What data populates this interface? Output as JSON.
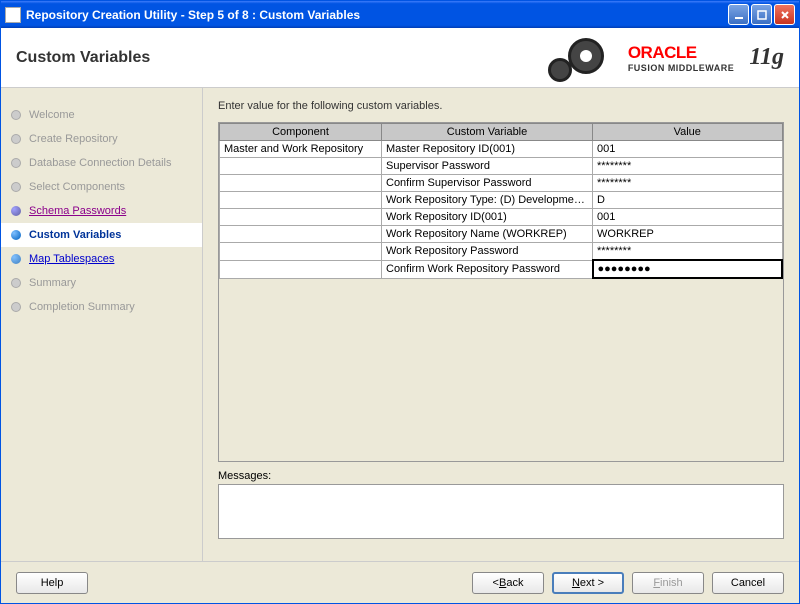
{
  "window": {
    "title": "Repository Creation Utility - Step 5 of 8 : Custom Variables"
  },
  "header": {
    "title": "Custom Variables",
    "brand_main": "ORACLE",
    "brand_sub": "FUSION MIDDLEWARE",
    "brand_version": "11g"
  },
  "sidebar": {
    "steps": [
      {
        "label": "Welcome",
        "state": "disabled"
      },
      {
        "label": "Create Repository",
        "state": "disabled"
      },
      {
        "label": "Database Connection Details",
        "state": "disabled"
      },
      {
        "label": "Select Components",
        "state": "disabled"
      },
      {
        "label": "Schema Passwords",
        "state": "past"
      },
      {
        "label": "Custom Variables",
        "state": "current"
      },
      {
        "label": "Map Tablespaces",
        "state": "future"
      },
      {
        "label": "Summary",
        "state": "disabled"
      },
      {
        "label": "Completion Summary",
        "state": "disabled"
      }
    ]
  },
  "main": {
    "instruction": "Enter value for the following custom variables.",
    "headers": {
      "component": "Component",
      "variable": "Custom Variable",
      "value": "Value"
    },
    "rows": [
      {
        "component": "Master and Work Repository",
        "variable": "Master Repository ID(001)",
        "value": "001"
      },
      {
        "component": "",
        "variable": "Supervisor Password",
        "value": "********"
      },
      {
        "component": "",
        "variable": "Confirm Supervisor Password",
        "value": "********"
      },
      {
        "component": "",
        "variable": "Work Repository Type: (D) Developmen...",
        "value": "D"
      },
      {
        "component": "",
        "variable": "Work Repository ID(001)",
        "value": "001"
      },
      {
        "component": "",
        "variable": "Work Repository Name (WORKREP)",
        "value": "WORKREP"
      },
      {
        "component": "",
        "variable": "Work Repository Password",
        "value": "********"
      },
      {
        "component": "",
        "variable": "Confirm Work Repository Password",
        "value": "●●●●●●●●",
        "active": true
      }
    ],
    "messages_label": "Messages:"
  },
  "buttons": {
    "help": "Help",
    "back": "< Back",
    "next": "Next >",
    "finish": "Finish",
    "cancel": "Cancel"
  }
}
